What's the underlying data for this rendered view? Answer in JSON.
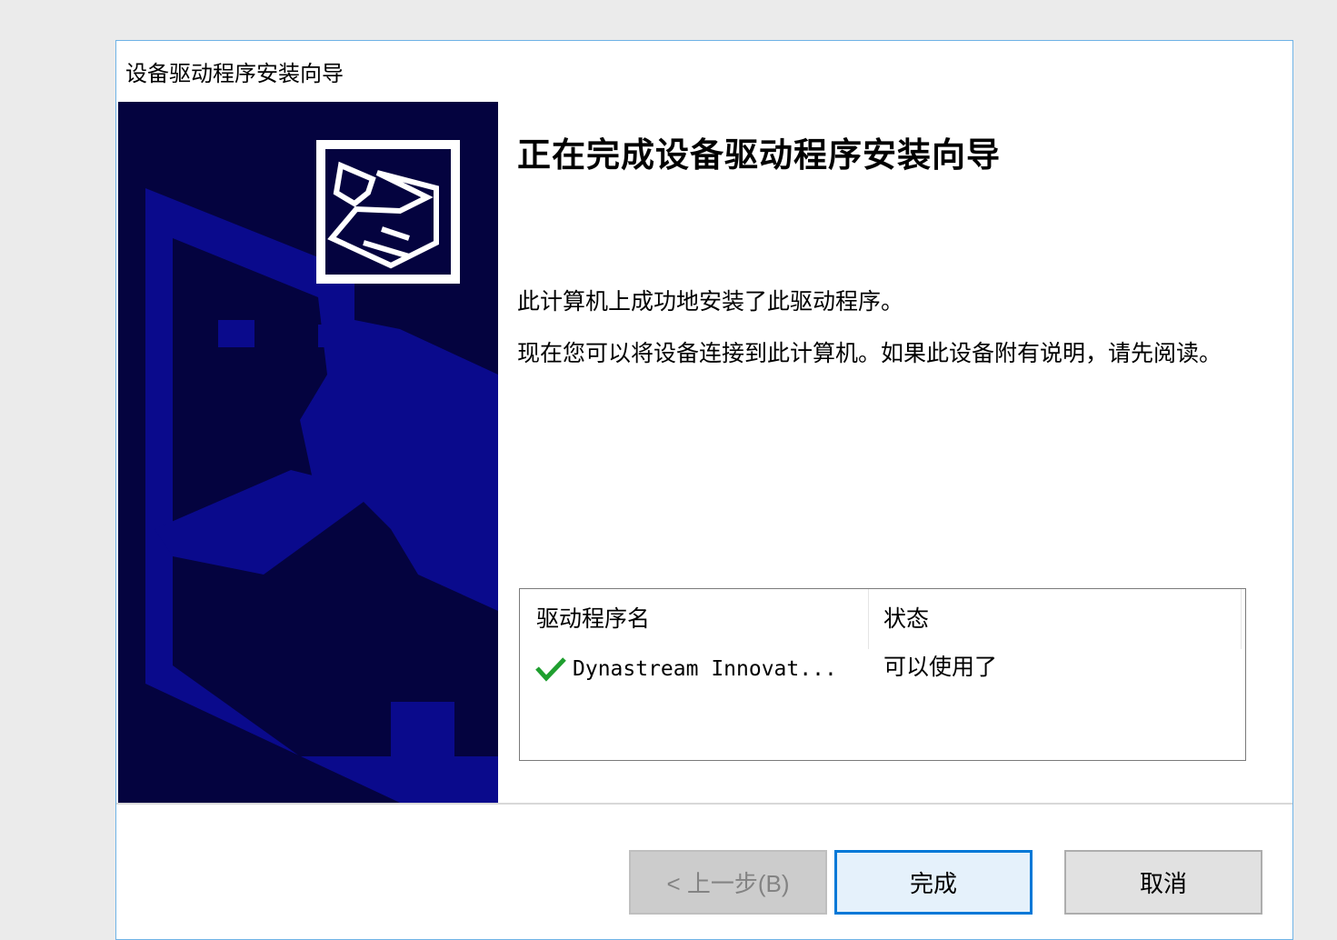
{
  "window": {
    "title": "设备驱动程序安装向导"
  },
  "content": {
    "heading": "正在完成设备驱动程序安装向导",
    "message_success": "此计算机上成功地安装了此驱动程序。",
    "message_connect": "现在您可以将设备连接到此计算机。如果此设备附有说明，请先阅读。"
  },
  "driver_list": {
    "columns": [
      "驱动程序名",
      "状态"
    ],
    "rows": [
      {
        "name": "Dynastream Innovat...",
        "status": "可以使用了",
        "icon": "checkmark-icon"
      }
    ]
  },
  "buttons": {
    "back": "< 上一步(B)",
    "finish": "完成",
    "cancel": "取消"
  },
  "colors": {
    "side_panel": "#04033f",
    "side_shapes": "#0a0a8c",
    "accent": "#0078d7",
    "check": "#1f9f2f"
  }
}
